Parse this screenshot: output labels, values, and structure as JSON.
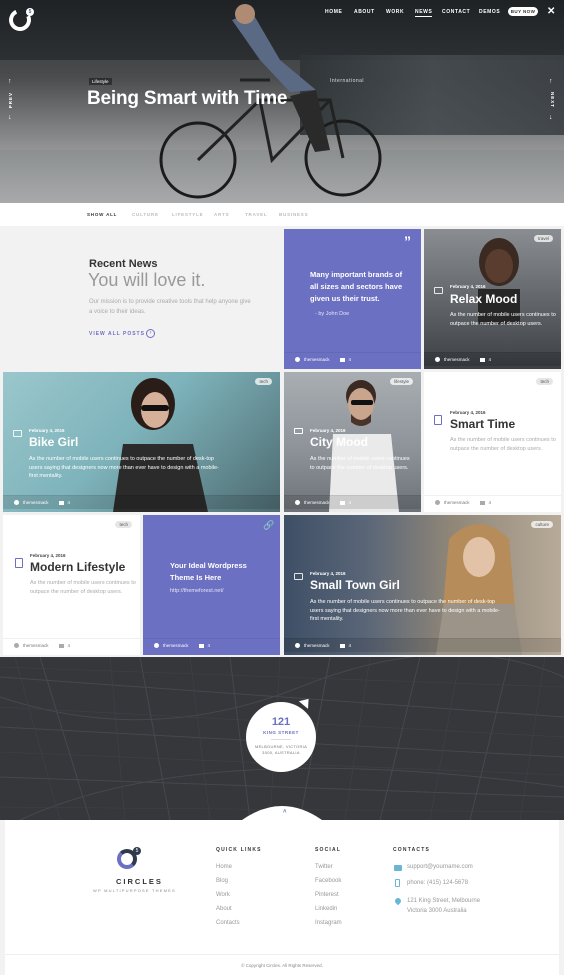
{
  "colors": {
    "accent": "#6b70c2",
    "dark": "#34363a"
  },
  "nav": {
    "items": [
      "HOME",
      "ABOUT",
      "WORK",
      "NEWS",
      "CONTACT",
      "DEMOS"
    ],
    "active": "NEWS",
    "buy_label": "BUY NOW"
  },
  "hero": {
    "tag": "Lifestyle",
    "title": "Being Smart with Time",
    "prev_label": "PREV",
    "next_label": "NEXT"
  },
  "filters": [
    "SHOW ALL",
    "CULTURE",
    "LIFESTYLE",
    "ARTS",
    "TRAVEL",
    "BUSINESS"
  ],
  "intro": {
    "heading": "Recent News",
    "subheading": "You will love it.",
    "text": "Our mission is to provide creative tools that help anyone give a voice to their ideas.",
    "link": "VIEW ALL POSTS"
  },
  "quote_card": {
    "quote": "Many important brands of all sizes and sectors have given us their trust.",
    "author": "- by John Doe",
    "user": "themesmack",
    "comments": "4"
  },
  "cards": {
    "relax": {
      "badge": "travel",
      "date": "February 4, 2016",
      "title": "Relax Mood",
      "excerpt": "As the number of mobile users continues to outpace the number of desktop users.",
      "user": "themesmack",
      "comments": "4"
    },
    "bike": {
      "badge": "tech",
      "date": "February 4, 2016",
      "title": "Bike Girl",
      "excerpt": "As the number of mobile users continues to outpace the number of desk-top users saying that designers now more than ever have to design with a mobile-first mentality.",
      "user": "themesmack",
      "comments": "4"
    },
    "city": {
      "badge": "lifestyle",
      "date": "February 4, 2016",
      "title": "City Mood",
      "excerpt": "As the number of mobile users continues to outpace the number of desktop users.",
      "user": "themesmack",
      "comments": "4"
    },
    "smart": {
      "badge": "tech",
      "date": "February 4, 2016",
      "title": "Smart Time",
      "excerpt": "As the number of mobile users continues to outpace the number of desktop users.",
      "user": "themesmack",
      "comments": "4"
    },
    "modern": {
      "badge": "tech",
      "date": "February 4, 2016",
      "title": "Modern Lifestyle",
      "excerpt": "As the number of mobile users continues to outpace the number of desktop users.",
      "user": "themesmack",
      "comments": "4"
    },
    "link": {
      "title": "Your Ideal Wordpress Theme Is Here",
      "url": "http://themeforest.net/",
      "user": "themesmack",
      "comments": "4"
    },
    "small": {
      "badge": "culture",
      "date": "February 4, 2016",
      "title": "Small Town Girl",
      "excerpt": "As the number of mobile users continues to outpace the number of desk-top users saying that designers now more than ever have to design with a mobile-first mentality.",
      "user": "themesmack",
      "comments": "4"
    }
  },
  "map": {
    "number": "121",
    "street": "KING STREET",
    "address_1": "MELBOURNE, VICTORIA",
    "address_2": "3000, AUSTRALIA"
  },
  "footer": {
    "brand": "CIRCLES",
    "tagline": "WP MULTIPURPOSE THEMES",
    "logo_badge": "5",
    "quick_links_title": "QUICK LINKS",
    "quick_links": [
      "Home",
      "Blog",
      "Work",
      "About",
      "Contacts"
    ],
    "social_title": "SOCIAL",
    "social": [
      "Twitter",
      "Facebook",
      "Pinterest",
      "Linkedin",
      "Instagram"
    ],
    "contacts_title": "CONTACTS",
    "email": "support@yourname.com",
    "phone": "phone: (415) 124-5678",
    "address_1": "121 King Street, Melbourne",
    "address_2": "Victoria 3000 Australia",
    "copyright": "© Copyright Circles. All Rights Reserved."
  }
}
